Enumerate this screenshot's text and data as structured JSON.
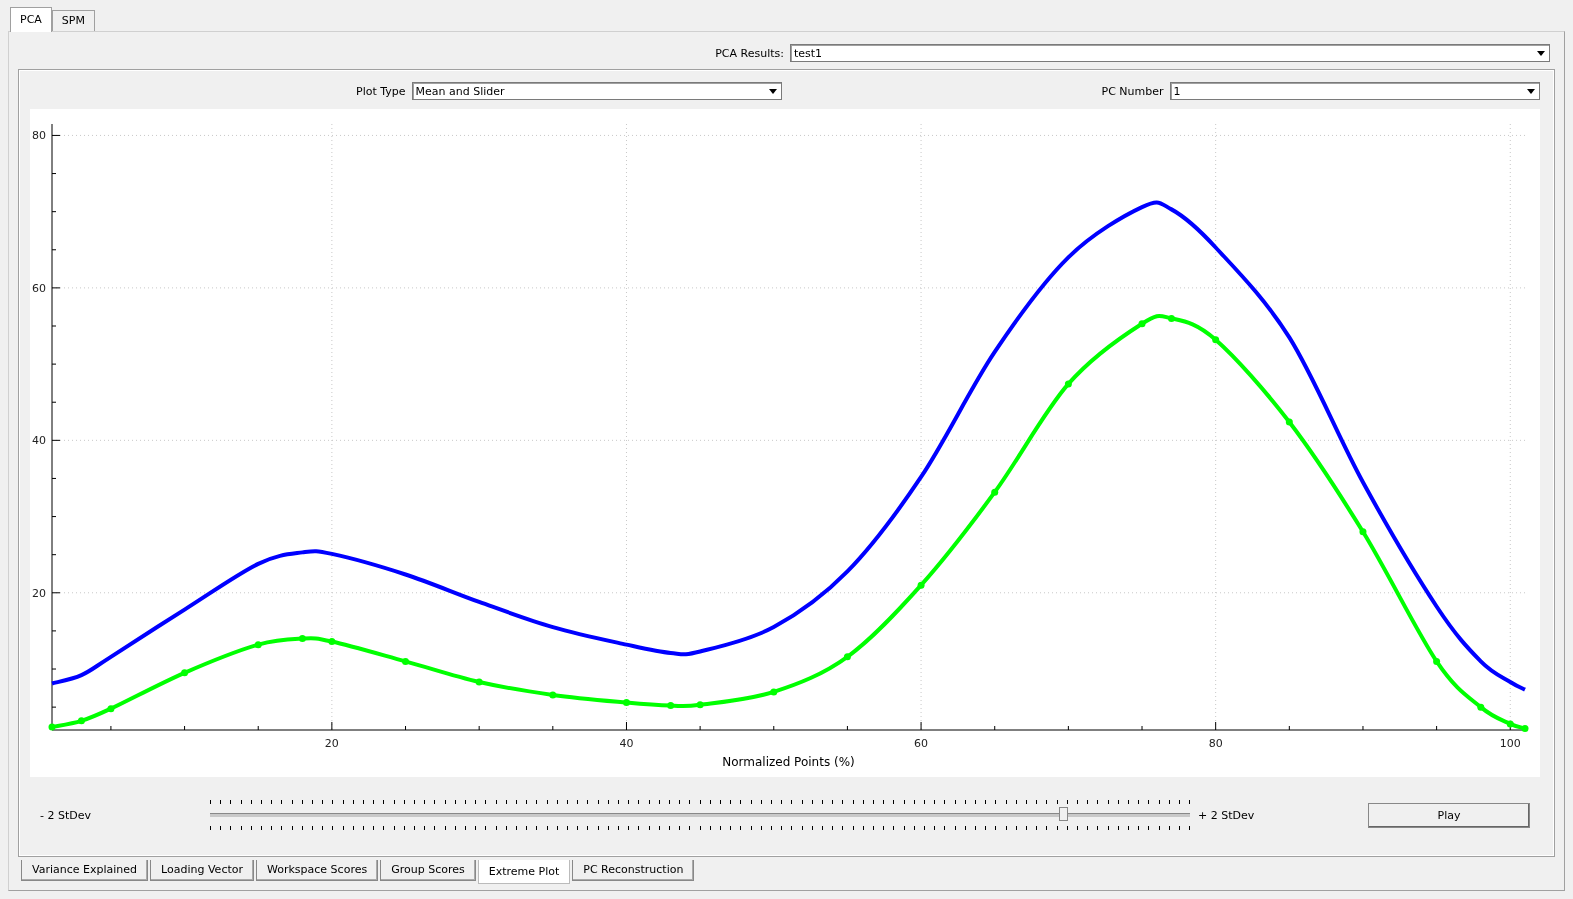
{
  "top_tabs": [
    {
      "label": "PCA",
      "selected": true
    },
    {
      "label": "SPM",
      "selected": false
    }
  ],
  "pca_results": {
    "label": "PCA Results:",
    "value": "test1"
  },
  "plot_type": {
    "label": "Plot Type",
    "value": "Mean and Slider"
  },
  "pc_number": {
    "label": "PC Number",
    "value": "1"
  },
  "chart_data": {
    "type": "line",
    "xlabel": "Normalized Points (%)",
    "xlim": [
      1,
      101
    ],
    "ylim": [
      2,
      81.5
    ],
    "xticks": [
      20,
      40,
      60,
      80,
      100
    ],
    "grid": true,
    "yticks": [
      20,
      40,
      60,
      80
    ],
    "x": [
      1,
      3,
      5,
      10,
      15,
      18,
      20,
      25,
      30,
      35,
      40,
      43,
      45,
      50,
      55,
      60,
      65,
      70,
      75,
      77,
      80,
      85,
      90,
      95,
      98,
      100,
      101
    ],
    "series": [
      {
        "color": "#0000ff",
        "values": [
          8.1,
          9.2,
          11.6,
          17.8,
          23.8,
          25.3,
          25.1,
          22.4,
          18.8,
          15.5,
          13.2,
          12.1,
          12.3,
          15.5,
          22.8,
          35.2,
          51.6,
          64,
          70.6,
          70.3,
          65.3,
          53.5,
          34.5,
          18.2,
          11,
          8.3,
          7.3
        ]
      },
      {
        "color": "#00ff00",
        "marker": "circle",
        "values": [
          2.4,
          3.2,
          4.8,
          9.5,
          13.2,
          14,
          13.6,
          11,
          8.3,
          6.6,
          5.6,
          5.2,
          5.3,
          7,
          11.6,
          21,
          33.2,
          47.4,
          55.3,
          56,
          53.2,
          42.4,
          28,
          11,
          5,
          2.8,
          2.2
        ]
      }
    ]
  },
  "slider": {
    "min_label": "- 2 StDev",
    "max_label": "+ 2 StDev",
    "level": 0.87
  },
  "play_button": "Play",
  "bottom_tabs": [
    {
      "label": "Variance Explained",
      "selected": false
    },
    {
      "label": "Loading Vector",
      "selected": false
    },
    {
      "label": "Workspace Scores",
      "selected": false
    },
    {
      "label": "Group Scores",
      "selected": false
    },
    {
      "label": "Extreme Plot",
      "selected": true
    },
    {
      "label": "PC Reconstruction",
      "selected": false
    }
  ]
}
